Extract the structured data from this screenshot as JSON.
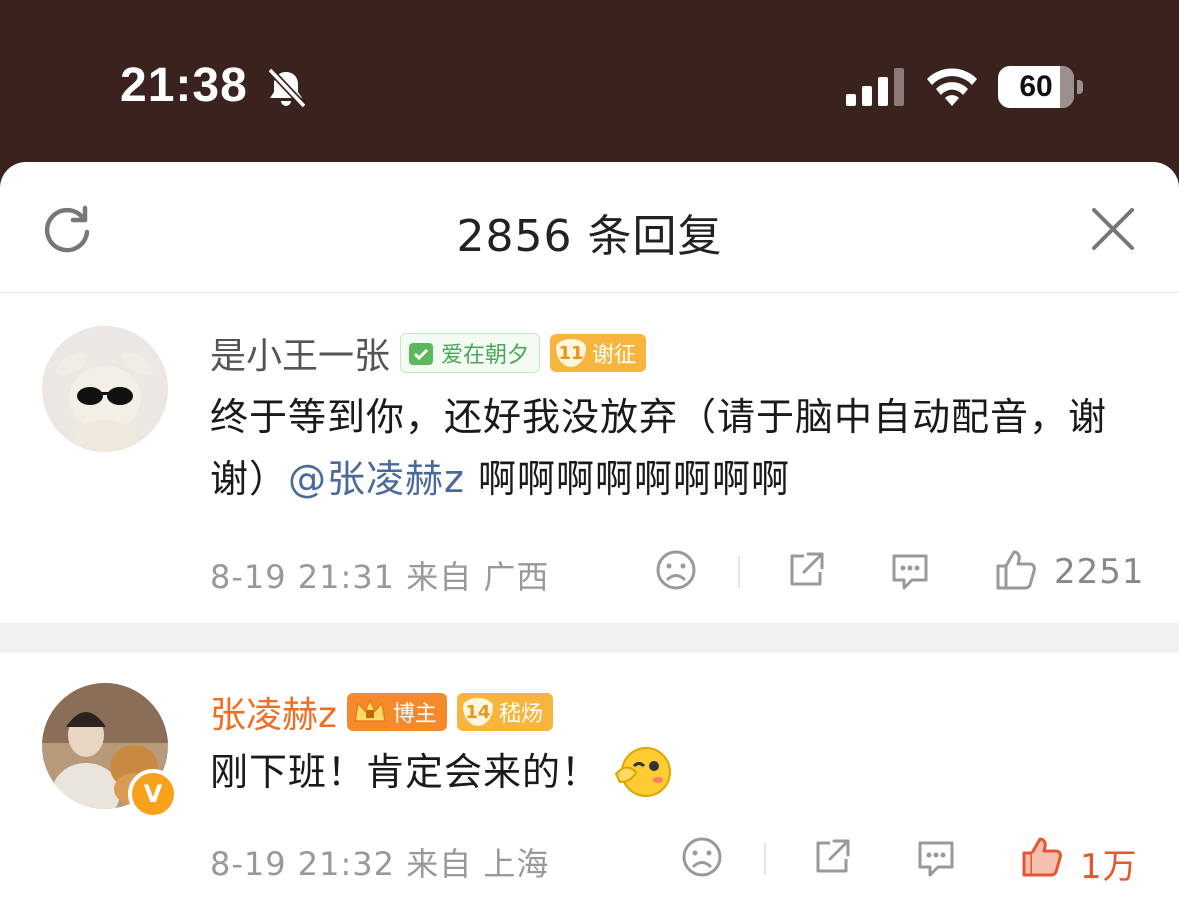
{
  "status_bar": {
    "time": "21:38",
    "battery_level": "60"
  },
  "header": {
    "title": "2856 条回复"
  },
  "comments": [
    {
      "username": "是小王一张",
      "badges": [
        {
          "text": "爱在朝夕",
          "style": "green"
        },
        {
          "level": "11",
          "text": "谢征",
          "style": "orange"
        }
      ],
      "text_before": "终于等到你，还好我没放弃（请于脑中自动配音，谢谢）",
      "mention": "@张凌赫z",
      "text_after": " 啊啊啊啊啊啊啊啊",
      "meta": "8-19 21:31 来自 广西",
      "likes": "2251",
      "liked": false
    },
    {
      "username": "张凌赫z",
      "badges": [
        {
          "text": "博主",
          "style": "orange"
        },
        {
          "level": "14",
          "text": "嵇炀",
          "style": "orange"
        }
      ],
      "text": "刚下班！肯定会来的！",
      "meta": "8-19 21:32 来自 上海",
      "likes": "1万",
      "liked": true,
      "verified_badge": "V"
    }
  ],
  "colors": {
    "status_bar_bg": "#3a231f",
    "blogger_name": "#f26d1f",
    "mention": "#4a6a9a",
    "like_active": "#e8552f"
  },
  "icons": {
    "status": [
      "bell-slash-icon",
      "signal-icon",
      "wifi-icon",
      "battery-icon"
    ],
    "header": [
      "refresh-icon",
      "close-icon"
    ],
    "actions": [
      "dislike-face-icon",
      "share-icon",
      "comment-icon",
      "thumbs-up-icon"
    ]
  }
}
